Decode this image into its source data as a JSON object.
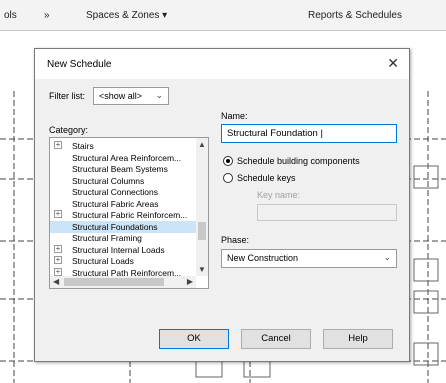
{
  "ribbon": {
    "tab_partial": "ols",
    "tab_sep": "»",
    "tab_spaces": "Spaces & Zones ▾",
    "tab_reports": "Reports & Schedules"
  },
  "dialog": {
    "title": "New Schedule",
    "close_glyph": "✕",
    "filter_label": "Filter list:",
    "filter_value": "<show all>",
    "category_label": "Category:",
    "categories": [
      {
        "label": "Stairs",
        "expandable": true
      },
      {
        "label": "Structural Area Reinforcem...",
        "expandable": false
      },
      {
        "label": "Structural Beam Systems",
        "expandable": false
      },
      {
        "label": "Structural Columns",
        "expandable": false
      },
      {
        "label": "Structural Connections",
        "expandable": false
      },
      {
        "label": "Structural Fabric Areas",
        "expandable": false
      },
      {
        "label": "Structural Fabric Reinforcem...",
        "expandable": true
      },
      {
        "label": "Structural Foundations",
        "expandable": false,
        "selected": true
      },
      {
        "label": "Structural Framing",
        "expandable": false
      },
      {
        "label": "Structural Internal Loads",
        "expandable": true
      },
      {
        "label": "Structural Loads",
        "expandable": true
      },
      {
        "label": "Structural Path Reinforcem...",
        "expandable": true
      }
    ],
    "name_label": "Name:",
    "name_value": "Structural Foundation |",
    "option_components": "Schedule building components",
    "option_keys": "Schedule keys",
    "selected_option": "components",
    "key_name_label": "Key name:",
    "phase_label": "Phase:",
    "phase_value": "New Construction",
    "ok_label": "OK",
    "cancel_label": "Cancel",
    "help_label": "Help"
  },
  "colors": {
    "selection": "#cce4f7",
    "focus_border": "#0078d7",
    "dialog_bg": "#f0f0f0"
  }
}
